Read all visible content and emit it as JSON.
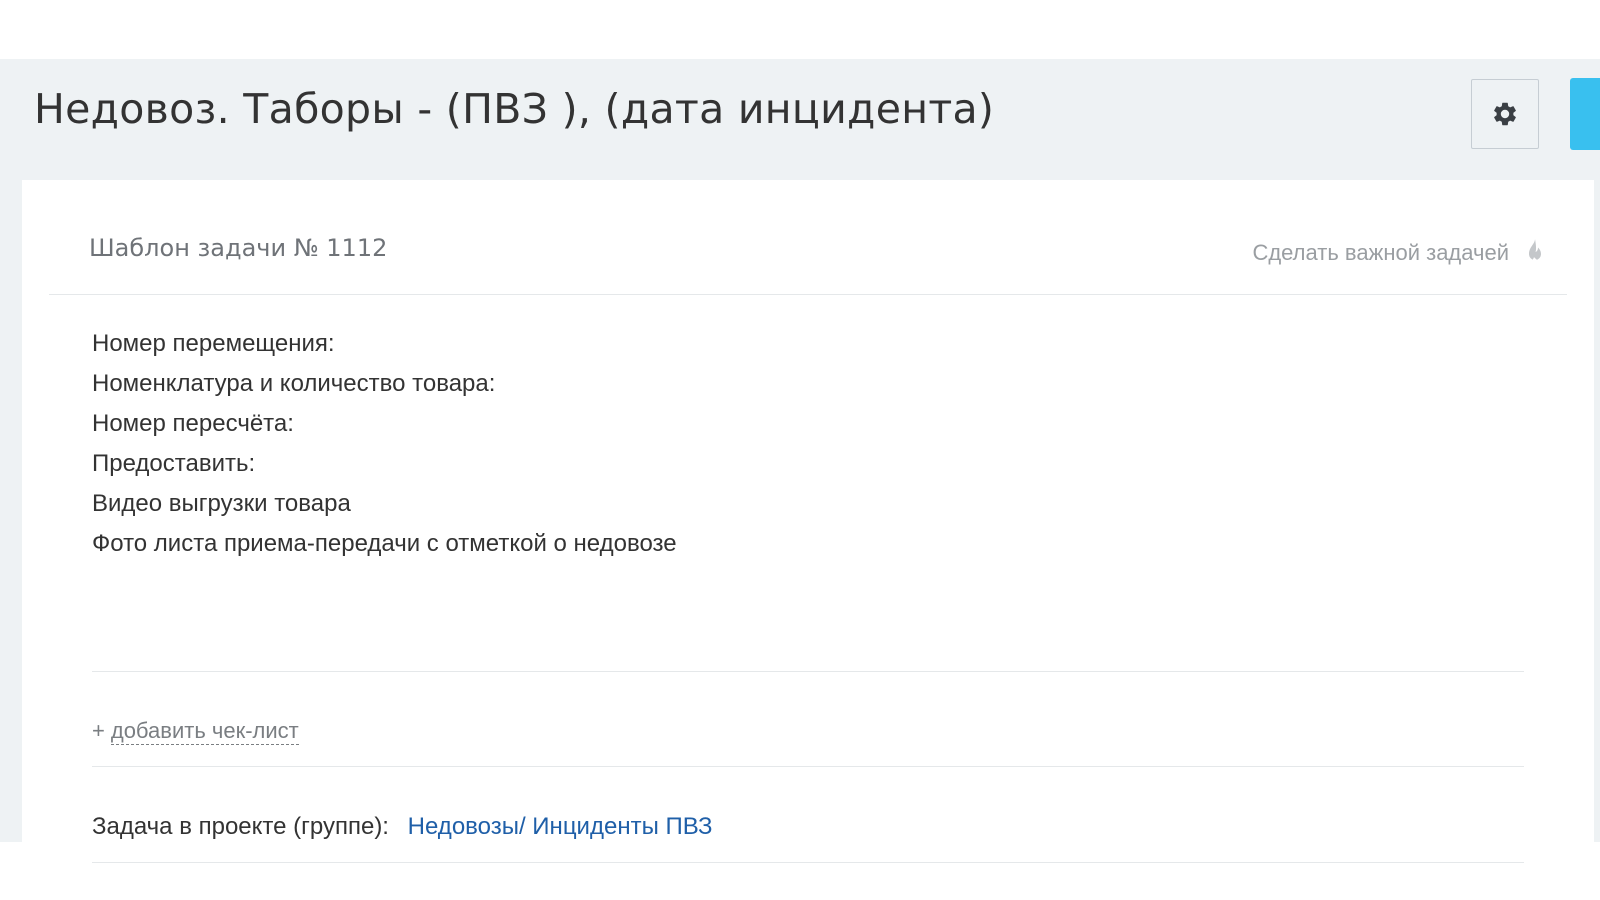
{
  "header": {
    "title": "Недовоз. Таборы - (ПВЗ ), (дата инцидента)",
    "settings_icon": "gear-icon"
  },
  "card": {
    "template_label": "Шаблон задачи № 1112",
    "important_toggle": {
      "label": "Сделать важной задачей",
      "icon": "flame-icon"
    },
    "description_lines": [
      "Номер перемещения:",
      "Номенклатура и количество товара:",
      "Номер пересчёта:",
      "Предоставить:",
      "Видео выгрузки товара",
      "Фото листа приема-передачи с отметкой о недовозе"
    ],
    "checklist": {
      "plus": "+",
      "label": "добавить чек-лист"
    },
    "project": {
      "label": "Задача в проекте (группе):",
      "link": "Недовозы/ Инциденты ПВЗ"
    }
  },
  "colors": {
    "page_background": "#eef2f4",
    "accent_blue": "#39c0ef",
    "link_blue": "#1f5fa8",
    "text_dark": "#333333",
    "text_muted": "#9a9ea2"
  }
}
